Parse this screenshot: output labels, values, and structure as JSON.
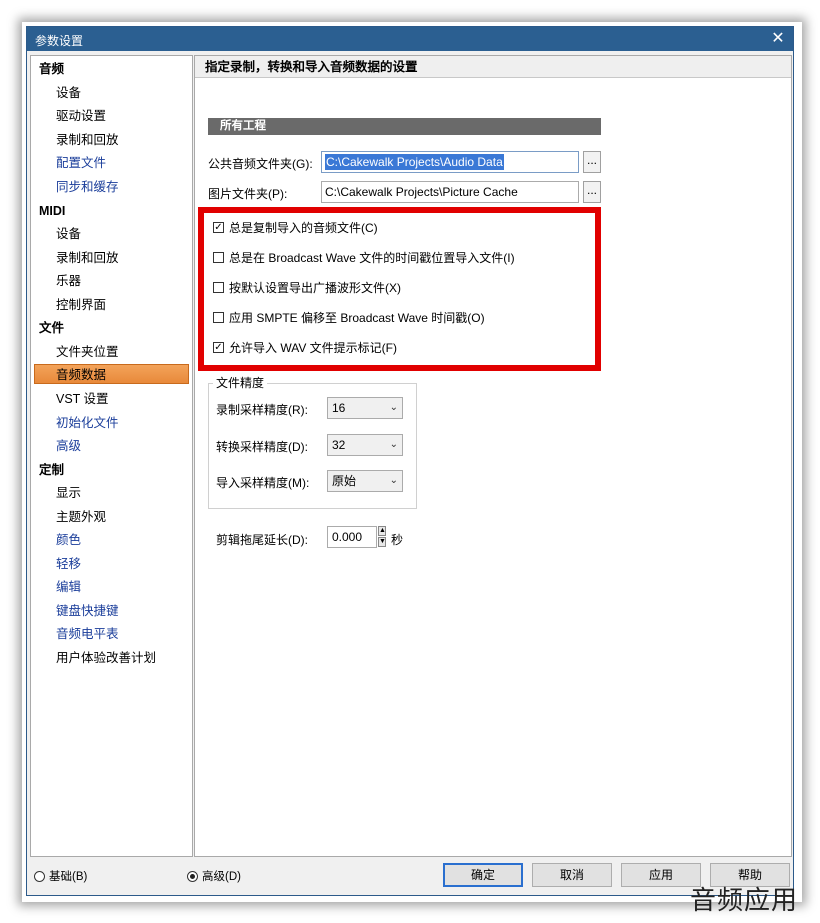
{
  "window": {
    "title": "参数设置",
    "close_glyph": "✕"
  },
  "sidebar": {
    "groups": [
      {
        "label": "音频",
        "items": [
          "设备",
          "驱动设置",
          "录制和回放",
          "配置文件",
          "同步和缓存"
        ]
      },
      {
        "label": "MIDI",
        "items": [
          "设备",
          "录制和回放",
          "乐器",
          "控制界面"
        ]
      },
      {
        "label": "文件",
        "items": [
          "文件夹位置",
          "音频数据",
          "VST 设置",
          "初始化文件",
          "高级"
        ]
      },
      {
        "label": "定制",
        "items": [
          "显示",
          "主题外观",
          "颜色",
          "轻移",
          "编辑",
          "键盘快捷键",
          "音频电平表",
          "用户体验改善计划"
        ]
      }
    ],
    "selected": "音频数据"
  },
  "panel": {
    "header": "指定录制，转换和导入音频数据的设置",
    "section": "所有工程",
    "shared_audio_label": "公共音频文件夹(G):",
    "shared_audio_value": "C:\\Cakewalk Projects\\Audio Data",
    "picture_label": "图片文件夹(P):",
    "picture_value": "C:\\Cakewalk Projects\\Picture Cache",
    "browse_label": "...",
    "checkboxes": [
      {
        "label": "总是复制导入的音频文件(C)",
        "checked": true
      },
      {
        "label": "总是在 Broadcast Wave 文件的时间戳位置导入文件(I)",
        "checked": false
      },
      {
        "label": "按默认设置导出广播波形文件(X)",
        "checked": false
      },
      {
        "label": "应用 SMPTE 偏移至 Broadcast Wave 时间戳(O)",
        "checked": false
      },
      {
        "label": "允许导入 WAV 文件提示标记(F)",
        "checked": true
      }
    ],
    "check_glyph": "✓",
    "file_precision": {
      "title": "文件精度",
      "record_label": "录制采样精度(R):",
      "record_value": "16",
      "convert_label": "转换采样精度(D):",
      "convert_value": "32",
      "import_label": "导入采样精度(M):",
      "import_value": "原始"
    },
    "tail_label": "剪辑拖尾延长(D):",
    "tail_value": "0.000",
    "tail_unit": "秒"
  },
  "footer": {
    "radio_basic": "基础(B)",
    "radio_advanced": "高级(D)",
    "ok": "确定",
    "cancel": "取消",
    "apply": "应用",
    "help": "帮助"
  },
  "watermark": "音频应用",
  "colors": {
    "titlebar": "#2b5f91",
    "highlight_box": "#e10000",
    "selected_item": "#e8893a"
  }
}
